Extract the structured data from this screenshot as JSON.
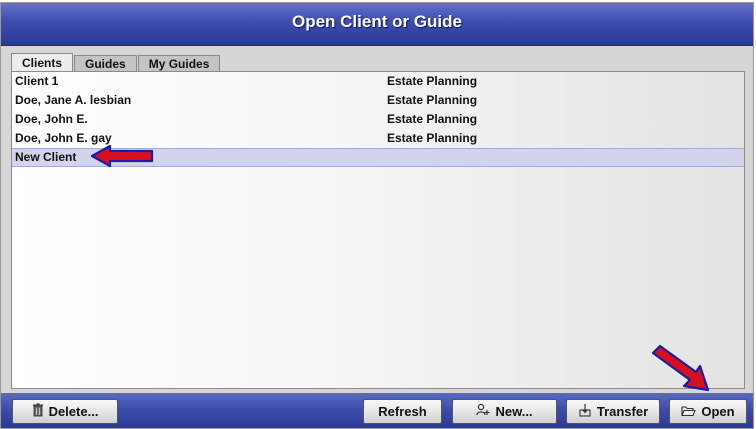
{
  "window": {
    "title": "Open Client or Guide"
  },
  "tabs": [
    {
      "label": "Clients",
      "active": true
    },
    {
      "label": "Guides",
      "active": false
    },
    {
      "label": "My Guides",
      "active": false
    }
  ],
  "clients": [
    {
      "name": "Client 1",
      "category": "Estate Planning"
    },
    {
      "name": "Doe, Jane A. lesbian",
      "category": "Estate Planning"
    },
    {
      "name": "Doe, John E.",
      "category": "Estate Planning"
    },
    {
      "name": "Doe, John E. gay",
      "category": "Estate Planning"
    },
    {
      "name": "New Client",
      "category": ""
    }
  ],
  "selected_row": "New Client",
  "buttons": {
    "delete": "Delete...",
    "refresh": "Refresh",
    "new": "New...",
    "transfer": "Transfer",
    "open": "Open"
  },
  "icons": {
    "delete": "trash-icon",
    "new": "person-add-icon",
    "transfer": "transfer-icon",
    "open": "folder-open-icon"
  },
  "annotation_color": "#d8101c"
}
